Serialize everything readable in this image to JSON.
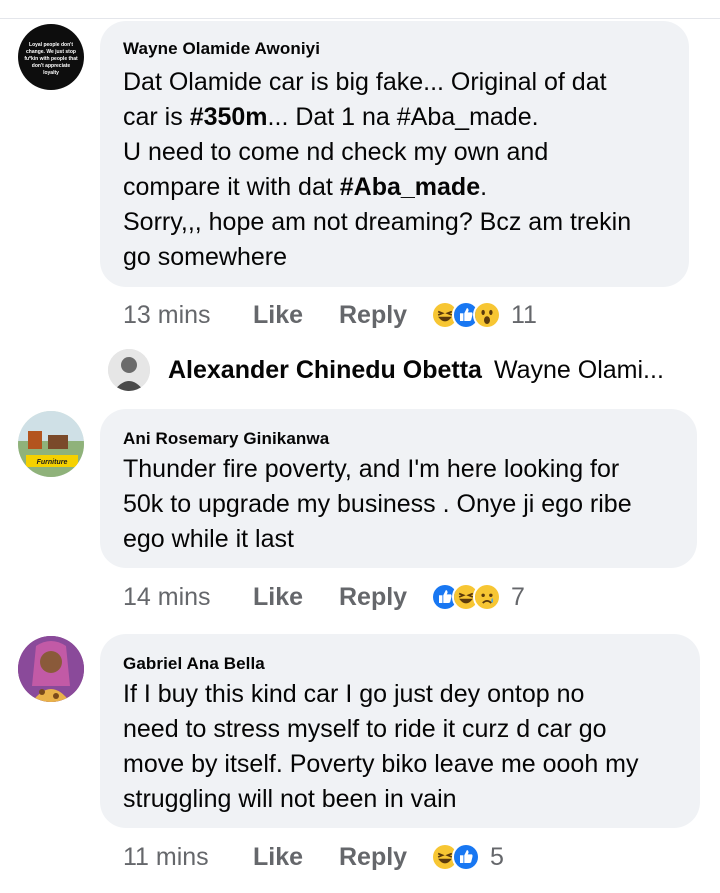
{
  "comments": [
    {
      "author": "Wayne Olamide Awoniyi",
      "avatar_text": "Loyal people don't change. We just stop fu*kin with people that don't appreciate loyalty",
      "lines": [
        [
          "Dat Olamide car is big fake... Original of dat"
        ],
        [
          "car is ",
          "#350m",
          "... Dat 1 na #Aba_made."
        ],
        [
          "U need to come nd check my own and"
        ],
        [
          "compare it with dat ",
          "#Aba_made",
          "."
        ],
        [
          "Sorry,,, hope am not dreaming? Bcz am trekin"
        ],
        [
          "go somewhere"
        ]
      ],
      "time": "13 mins",
      "like": "Like",
      "reply": "Reply",
      "reactions": [
        "haha-icon",
        "like-icon",
        "wow-icon"
      ],
      "reaction_count": "11"
    },
    {
      "author": "Ani Rosemary Ginikanwa",
      "avatar_text": "Furniture",
      "lines": [
        [
          "Thunder fire poverty,  and I'm here looking for"
        ],
        [
          "50k to upgrade my business .  Onye ji ego ribe"
        ],
        [
          "ego while it last"
        ]
      ],
      "time": "14 mins",
      "like": "Like",
      "reply": "Reply",
      "reactions": [
        "like-icon",
        "haha-icon",
        "sad-icon"
      ],
      "reaction_count": "7"
    },
    {
      "author": "Gabriel Ana Bella",
      "lines": [
        [
          "If I buy this kind car I go just dey ontop no"
        ],
        [
          "need to stress myself to ride it curz d car go"
        ],
        [
          "move by itself. Poverty biko leave me oooh my"
        ],
        [
          "struggling will not been in vain"
        ]
      ],
      "time": "11 mins",
      "like": "Like",
      "reply": "Reply",
      "reactions": [
        "haha-icon",
        "like-icon"
      ],
      "reaction_count": "5"
    }
  ],
  "reply_preview": {
    "name": "Alexander Chinedu Obetta",
    "text": "Wayne Olami..."
  },
  "colors": {
    "bubble": "#f0f2f5",
    "meta_text": "#65676b",
    "like_blue": "#1877f2",
    "emoji_yellow": "#f7c633"
  }
}
